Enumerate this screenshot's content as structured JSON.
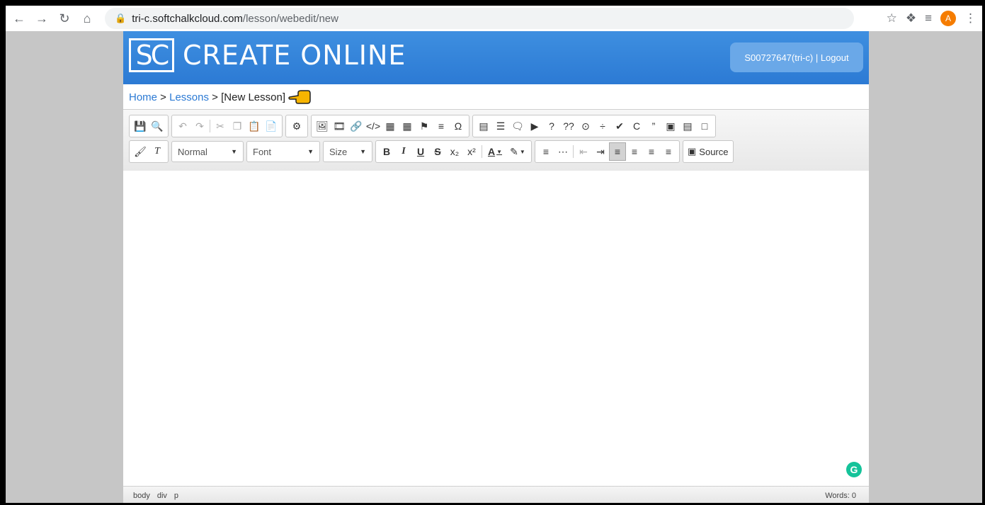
{
  "browser": {
    "url_host": "tri-c.softchalkcloud.com",
    "url_path": "/lesson/webedit/new",
    "avatar_letter": "A"
  },
  "header": {
    "logo_letters": "SC",
    "title": "CREATE ONLINE",
    "user_label": "S00727647(tri-c) | Logout"
  },
  "breadcrumb": {
    "home": "Home",
    "sep1": " > ",
    "lessons": "Lessons",
    "sep2": " > ",
    "current": "[New Lesson]"
  },
  "toolbar": {
    "format_combo": "Normal",
    "font_combo": "Font",
    "size_combo": "Size",
    "bold": "B",
    "italic": "I",
    "underline": "U",
    "strike": "S",
    "color_text": "A",
    "question": "?",
    "questions": "??",
    "source_label": "Source"
  },
  "statusbar": {
    "path": [
      "body",
      "div",
      "p"
    ],
    "words": "Words: 0"
  },
  "colors": {
    "header_blue": "#2c7ad4",
    "grammarly_green": "#15c39a",
    "avatar_orange": "#f57c00"
  }
}
